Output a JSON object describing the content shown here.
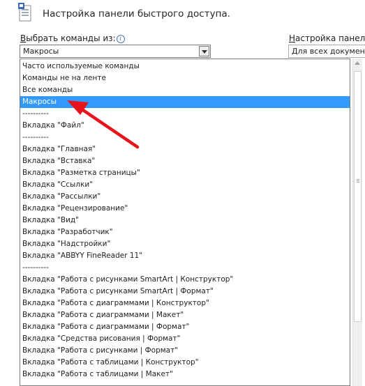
{
  "header": {
    "title": "Настройка панели быстрого доступа."
  },
  "choose_commands": {
    "label_underlined": "В",
    "label_rest": "ыбрать команды из:",
    "info_glyph": "i",
    "selected_value": "Макросы"
  },
  "customize": {
    "label_underlined": "Н",
    "label_rest": "астройка панели б",
    "selected_value": "Для всех документо"
  },
  "list_items": [
    "Часто используемые команды",
    "Команды не на ленте",
    "Все команды",
    "Макросы",
    "----------",
    "Вкладка \"Файл\"",
    "----------",
    "Вкладка \"Главная\"",
    "Вкладка \"Вставка\"",
    "Вкладка \"Разметка страницы\"",
    "Вкладка \"Ссылки\"",
    "Вкладка \"Рассылки\"",
    "Вкладка \"Рецензирование\"",
    "Вкладка \"Вид\"",
    "Вкладка \"Разработчик\"",
    "Вкладка \"Надстройки\"",
    "Вкладка \"ABBYY FineReader 11\"",
    "----------",
    "Вкладка \"Работа с рисунками SmartArt | Конструктор\"",
    "Вкладка \"Работа с рисунками SmartArt | Формат\"",
    "Вкладка \"Работа с диаграммами | Конструктор\"",
    "Вкладка \"Работа с диаграммами | Макет\"",
    "Вкладка \"Работа с диаграммами | Формат\"",
    "Вкладка \"Средства рисования | Формат\"",
    "Вкладка \"Работа с рисунками | Формат\"",
    "Вкладка \"Работа с таблицами | Конструктор\"",
    "Вкладка \"Работа с таблицами | Макет\""
  ],
  "selected_index": 3,
  "colors": {
    "selection": "#3399ff",
    "annotation_arrow": "#e8141b"
  },
  "icons": {
    "header": "quick-access-toolbar-icon",
    "arrow": "red-annotation-arrow"
  }
}
